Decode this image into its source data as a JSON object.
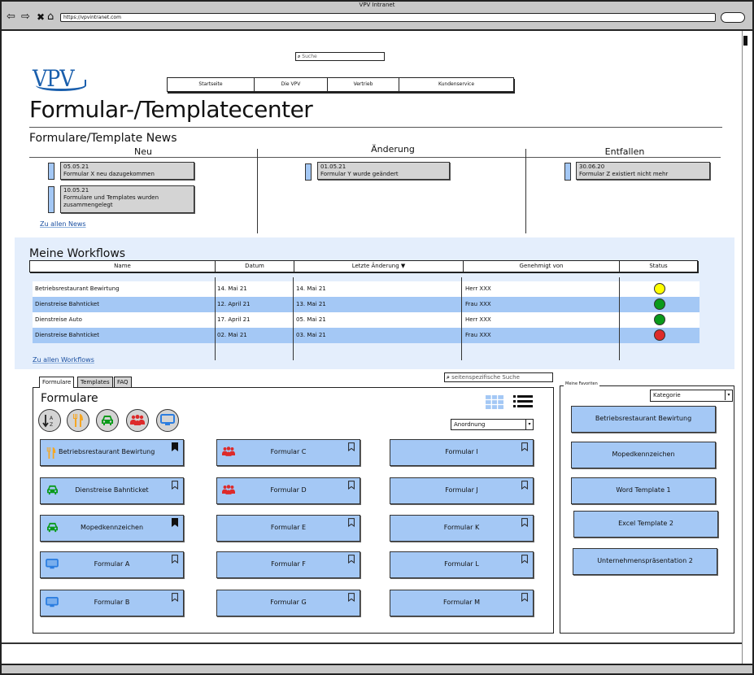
{
  "browser": {
    "title": "VPV Intranet",
    "url": "https://vpvintranet.com",
    "icons": [
      "back-arrow-icon",
      "forward-arrow-icon",
      "stop-icon",
      "home-icon"
    ]
  },
  "header": {
    "search_placeholder": "Suche",
    "logo_text": "VPV",
    "nav": [
      "Startseite",
      "Die VPV",
      "Vertrieb",
      "Kundenservice"
    ],
    "page_title": "Formular-/Templatecenter"
  },
  "news": {
    "title": "Formulare/Template News",
    "columns": [
      {
        "label": "Neu",
        "items": [
          {
            "date": "05.05.21",
            "text": "Formular X neu dazugekommen"
          },
          {
            "date": "10.05.21",
            "text": "Formulare und Templates wurden zusammengelegt"
          }
        ]
      },
      {
        "label": "Änderung",
        "items": [
          {
            "date": "01.05.21",
            "text": "Formular Y wurde geändert"
          }
        ]
      },
      {
        "label": "Entfallen",
        "items": [
          {
            "date": "30.06.20",
            "text": "Formular Z existiert nicht mehr"
          }
        ]
      }
    ],
    "all_link": "Zu allen News"
  },
  "workflows": {
    "title": "Meine Workflows",
    "headers": [
      "Name",
      "Datum",
      "Letzte Änderung ▼",
      "Genehmigt von",
      "Status"
    ],
    "rows": [
      {
        "name": "Betriebsrestaurant Bewirtung",
        "date": "14. Mai 21",
        "changed": "14. Mai 21",
        "approver": "Herr XXX",
        "status": "pending",
        "status_color": "#ffff00"
      },
      {
        "name": "Dienstreise Bahnticket",
        "date": "12. April 21",
        "changed": "13. Mai 21",
        "approver": "Frau XXX",
        "status": "approved",
        "status_color": "#0a9a1a"
      },
      {
        "name": "Dienstreise Auto",
        "date": "17. April 21",
        "changed": "05. Mai 21",
        "approver": "Herr XXX",
        "status": "approved",
        "status_color": "#0a9a1a"
      },
      {
        "name": "Dienstreise Bahnticket",
        "date": "02. Mai 21",
        "changed": "03. Mai 21",
        "approver": "Frau XXX",
        "status": "rejected",
        "status_color": "#dd2a2a"
      }
    ],
    "all_link": "Zu allen Workflows"
  },
  "forms_area": {
    "tabs": [
      "Formulare",
      "Templates",
      "FAQ"
    ],
    "active_tab": "Formulare",
    "page_search_placeholder": "seitenspezifische Suche",
    "title": "Formulare",
    "filters": [
      {
        "name": "sort-az",
        "color": "#222222"
      },
      {
        "name": "restaurant",
        "color": "#f5a623"
      },
      {
        "name": "car",
        "color": "#0a9a1a"
      },
      {
        "name": "group",
        "color": "#dd2a2a"
      },
      {
        "name": "monitor",
        "color": "#2b7de0"
      }
    ],
    "sort_select": "Anordnung",
    "view_modes": [
      "grid",
      "list"
    ],
    "cards": [
      [
        {
          "label": "Betriebsrestaurant Bewirtung",
          "icon": "restaurant",
          "bookmarked": true
        },
        {
          "label": "Dienstreise Bahnticket",
          "icon": "car",
          "bookmarked": false
        },
        {
          "label": "Mopedkennzeichen",
          "icon": "car",
          "bookmarked": true
        },
        {
          "label": "Formular A",
          "icon": "monitor",
          "bookmarked": false
        },
        {
          "label": "Formular B",
          "icon": "monitor",
          "bookmarked": false
        }
      ],
      [
        {
          "label": "Formular C",
          "icon": "group",
          "bookmarked": false
        },
        {
          "label": "Formular D",
          "icon": "group",
          "bookmarked": false
        },
        {
          "label": "Formular E",
          "icon": "",
          "bookmarked": false
        },
        {
          "label": "Formular F",
          "icon": "",
          "bookmarked": false
        },
        {
          "label": "Formular G",
          "icon": "",
          "bookmarked": false
        }
      ],
      [
        {
          "label": "Formular I",
          "icon": "",
          "bookmarked": false
        },
        {
          "label": "Formular J",
          "icon": "",
          "bookmarked": false
        },
        {
          "label": "Formular K",
          "icon": "",
          "bookmarked": false
        },
        {
          "label": "Formular L",
          "icon": "",
          "bookmarked": false
        },
        {
          "label": "Formular M",
          "icon": "",
          "bookmarked": false
        }
      ]
    ]
  },
  "favorites": {
    "legend": "Meine Favoriten",
    "select": "Kategorie",
    "items": [
      "Betriebsrestaurant Bewirtung",
      "Mopedkennzeichen",
      "Word Template 1",
      "Excel Template 2",
      "Unternehmenspräsentation 2"
    ]
  },
  "colors": {
    "accent_blue": "#a4c8f5",
    "panel_bg": "#e4eefc",
    "logo_blue": "#1a5fad",
    "link_blue": "#1a4fa0"
  }
}
